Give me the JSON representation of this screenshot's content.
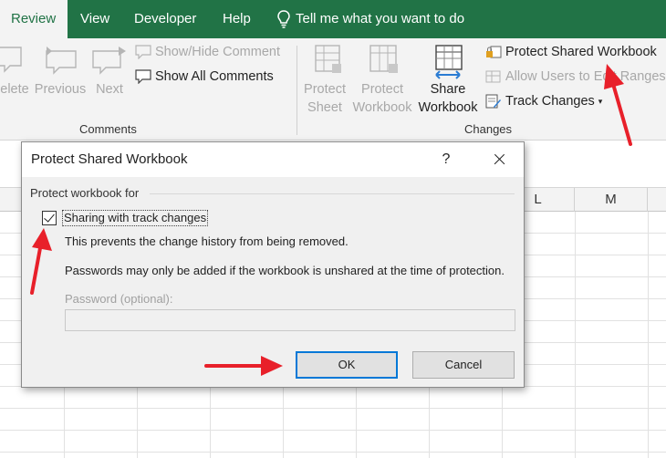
{
  "menu": {
    "tabs": [
      "Review",
      "View",
      "Developer",
      "Help"
    ],
    "tell_me": "Tell me what you want to do"
  },
  "ribbon": {
    "comments_group": {
      "delete": "elete",
      "previous": "Previous",
      "next": "Next",
      "show_hide": "Show/Hide Comment",
      "show_all": "Show All Comments",
      "label": "Comments"
    },
    "changes_group": {
      "protect_sheet": [
        "Protect",
        "Sheet"
      ],
      "protect_workbook": [
        "Protect",
        "Workbook"
      ],
      "share_workbook": [
        "Share",
        "Workbook"
      ],
      "protect_shared": "Protect Shared Workbook",
      "allow_users": "Allow Users to Edit Ranges",
      "track_changes": "Track Changes",
      "label": "Changes"
    }
  },
  "columns": [
    "L",
    "M"
  ],
  "dialog": {
    "title": "Protect Shared Workbook",
    "help": "?",
    "group_label": "Protect workbook for",
    "checkbox_label": "Sharing with track changes",
    "checkbox_checked": true,
    "line1": "This prevents the change history from being removed.",
    "line2": "Passwords may only be added if the workbook is unshared at the time of protection.",
    "password_label": "Password (optional):",
    "password_value": "",
    "ok": "OK",
    "cancel": "Cancel"
  },
  "colors": {
    "excel_green": "#217346",
    "arrow_red": "#e8202a",
    "focus_blue": "#0078d7"
  }
}
